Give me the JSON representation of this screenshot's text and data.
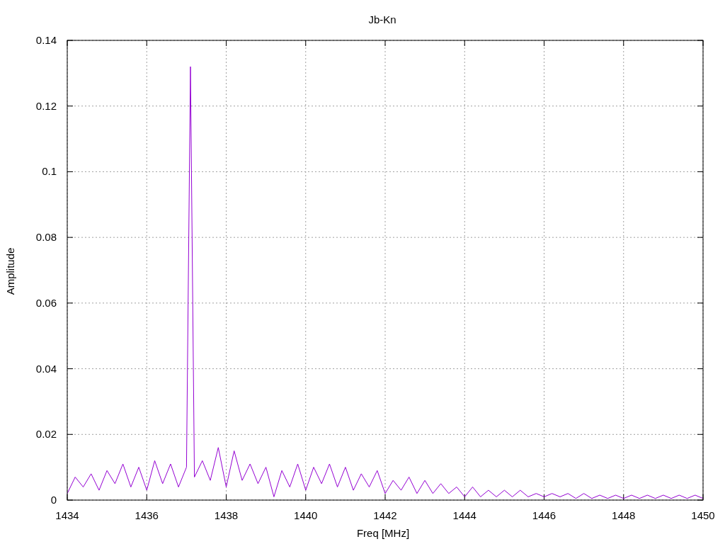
{
  "chart_data": {
    "type": "line",
    "title": "Jb-Kn",
    "xlabel": "Freq [MHz]",
    "ylabel": "Amplitude",
    "x": [
      1434.0,
      1434.2,
      1434.4,
      1434.6,
      1434.8,
      1435.0,
      1435.2,
      1435.4,
      1435.6,
      1435.8,
      1436.0,
      1436.2,
      1436.4,
      1436.6,
      1436.8,
      1437.0,
      1437.1,
      1437.2,
      1437.4,
      1437.6,
      1437.8,
      1438.0,
      1438.2,
      1438.4,
      1438.6,
      1438.8,
      1439.0,
      1439.2,
      1439.4,
      1439.6,
      1439.8,
      1440.0,
      1440.2,
      1440.4,
      1440.6,
      1440.8,
      1441.0,
      1441.2,
      1441.4,
      1441.6,
      1441.8,
      1442.0,
      1442.2,
      1442.4,
      1442.6,
      1442.8,
      1443.0,
      1443.2,
      1443.4,
      1443.6,
      1443.8,
      1444.0,
      1444.2,
      1444.4,
      1444.6,
      1444.8,
      1445.0,
      1445.2,
      1445.4,
      1445.6,
      1445.8,
      1446.0,
      1446.2,
      1446.4,
      1446.6,
      1446.8,
      1447.0,
      1447.2,
      1447.4,
      1447.6,
      1447.8,
      1448.0,
      1448.2,
      1448.4,
      1448.6,
      1448.8,
      1449.0,
      1449.2,
      1449.4,
      1449.6,
      1449.8,
      1450.0
    ],
    "values": [
      0.002,
      0.007,
      0.004,
      0.008,
      0.003,
      0.009,
      0.005,
      0.011,
      0.004,
      0.01,
      0.003,
      0.012,
      0.005,
      0.011,
      0.004,
      0.01,
      0.132,
      0.007,
      0.012,
      0.006,
      0.016,
      0.004,
      0.015,
      0.006,
      0.011,
      0.005,
      0.01,
      0.001,
      0.009,
      0.004,
      0.011,
      0.003,
      0.01,
      0.005,
      0.011,
      0.004,
      0.01,
      0.003,
      0.008,
      0.004,
      0.009,
      0.002,
      0.006,
      0.003,
      0.007,
      0.002,
      0.006,
      0.002,
      0.005,
      0.002,
      0.004,
      0.001,
      0.004,
      0.001,
      0.003,
      0.001,
      0.003,
      0.001,
      0.003,
      0.001,
      0.002,
      0.001,
      0.002,
      0.001,
      0.002,
      0.0005,
      0.002,
      0.0005,
      0.0015,
      0.0005,
      0.0015,
      0.0005,
      0.0015,
      0.0005,
      0.0015,
      0.0005,
      0.0015,
      0.0005,
      0.0015,
      0.0005,
      0.0015,
      0.0005
    ],
    "xlim": [
      1434,
      1450
    ],
    "ylim": [
      0,
      0.14
    ],
    "xticks": [
      1434,
      1436,
      1438,
      1440,
      1442,
      1444,
      1446,
      1448,
      1450
    ],
    "yticks": [
      0,
      0.02,
      0.04,
      0.06,
      0.08,
      0.1,
      0.12,
      0.14
    ],
    "grid": true
  }
}
